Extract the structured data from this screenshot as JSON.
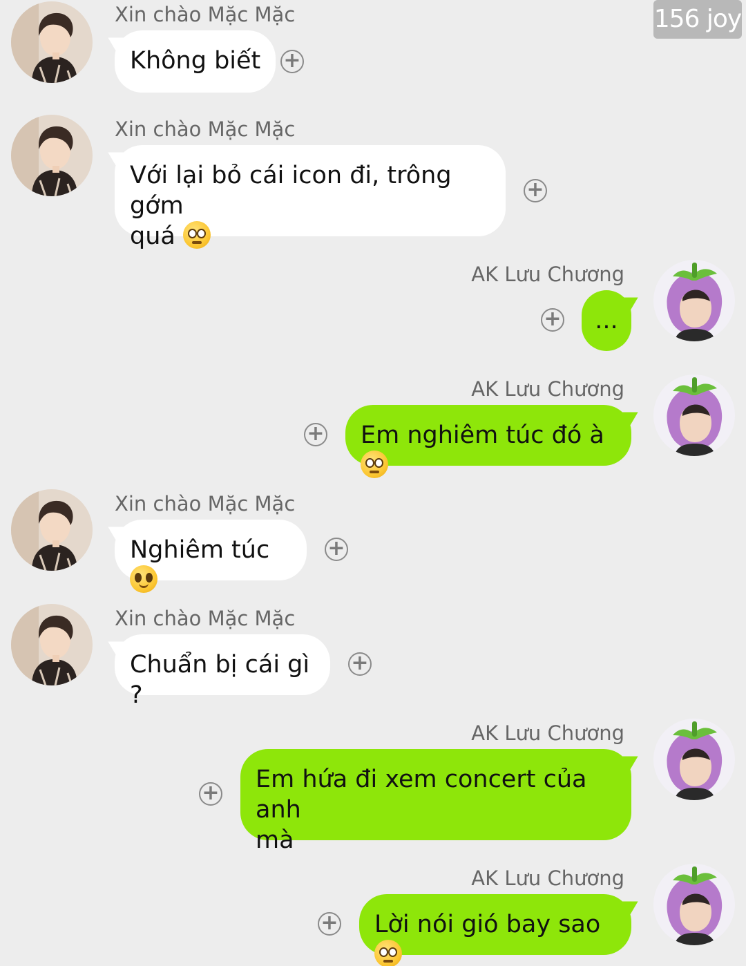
{
  "watermark": "156 joy",
  "contacts": {
    "left_name": "Xin chào Mặc Mặc",
    "right_name": "AK Lưu Chương"
  },
  "messages": [
    {
      "side": "left",
      "sender": "Xin chào Mặc Mặc",
      "text": "Không biết"
    },
    {
      "side": "left",
      "sender": "Xin chào Mặc Mặc",
      "text": "Với lại bỏ cái icon đi, trông gớm",
      "text2": "quá",
      "emoji": "eye-roll-emoji"
    },
    {
      "side": "right",
      "sender": "AK Lưu Chương",
      "text": "..."
    },
    {
      "side": "right",
      "sender": "AK Lưu Chương",
      "text": "Em nghiêm túc đó à",
      "emoji": "pleading-face-emoji"
    },
    {
      "side": "left",
      "sender": "Xin chào Mặc Mặc",
      "text": "Nghiêm túc",
      "emoji": "smiling-face-emoji"
    },
    {
      "side": "left",
      "sender": "Xin chào Mặc Mặc",
      "text": "Chuẩn bị cái gì ?"
    },
    {
      "side": "right",
      "sender": "AK Lưu Chương",
      "text": "Em hứa đi xem concert của anh",
      "text2": "mà"
    },
    {
      "side": "right",
      "sender": "AK Lưu Chương",
      "text": "Lời nói gió bay sao",
      "emoji": "pleading-face-emoji"
    }
  ],
  "colors": {
    "background": "#ededed",
    "incoming_bubble": "#ffffff",
    "outgoing_bubble": "#8ee60a"
  },
  "icons": {
    "add": "plus-circle-icon"
  }
}
